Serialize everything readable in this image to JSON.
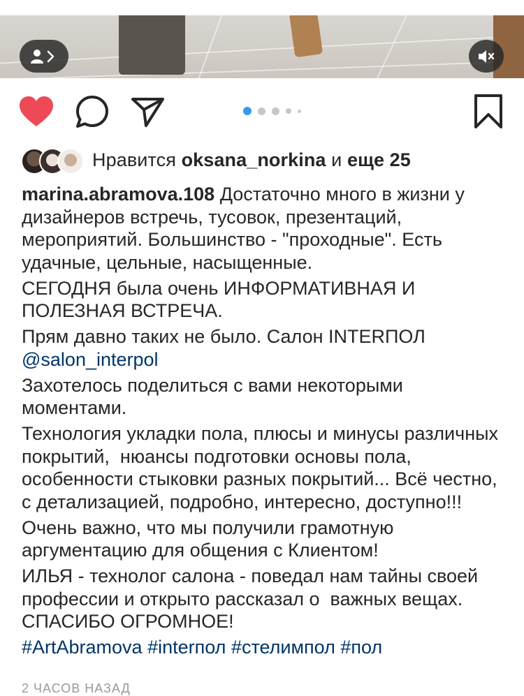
{
  "post": {
    "likes": {
      "prefix": "Нравится",
      "user": "oksana_norkina",
      "middle": "и",
      "suffix": "еще 25"
    },
    "author": "marina.abramova.108",
    "caption_first": "Достаточно много в жизни у дизайнеров встречь, тусовок, презентаций, мероприятий. Большинство - \"проходные\". Есть удачные, цельные, насыщенные.",
    "p2": "СЕГОДНЯ была очень ИНФОРМАТИВНАЯ И ПОЛЕЗНАЯ ВСТРЕЧА.",
    "p3": "Прям давно таких не было. Салон INTERПОЛ",
    "mention": "@salon_interpol",
    "p4": "Захотелось поделиться с вами некоторыми моментами.",
    "p5": "Технология укладки пола, плюсы и минусы различных покрытий,  нюансы подготовки основы пола, особенности стыковки разных покрытий... Всё честно, с детализацией, подробно, интересно, доступно!!!",
    "p6": "Очень важно, что мы получили грамотную аргументацию для общения с Клиентом!",
    "p7": "ИЛЬЯ - технолог салона - поведал нам тайны своей профессии и открыто рассказал о  важных вещах. СПАСИБО ОГРОМНОЕ!",
    "hashtags": [
      "#ArtAbramova",
      "#interпол",
      "#стелимпол",
      "#пол"
    ],
    "time": "2 ЧАСОВ НАЗАД"
  },
  "carousel": {
    "total": 5,
    "active": 0,
    "active_color": "#3897f0"
  },
  "colors": {
    "like": "#ed4956",
    "link": "#003569",
    "text": "#262626"
  },
  "icons": [
    "user-tag-icon",
    "mute-icon",
    "heart-icon",
    "comment-icon",
    "share-icon",
    "bookmark-icon"
  ]
}
